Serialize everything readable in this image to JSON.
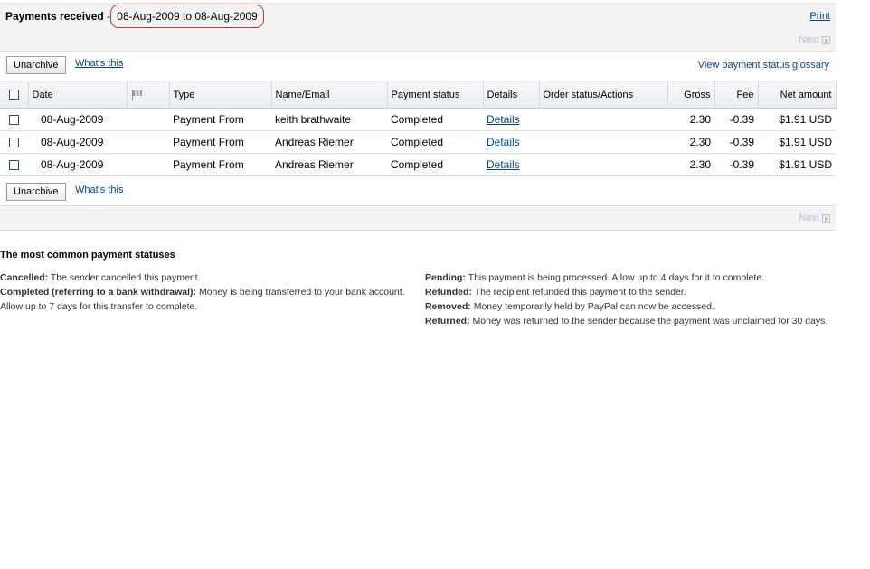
{
  "header": {
    "title": "Payments received",
    "dash": "-",
    "date_range": "08-Aug-2009 to 08-Aug-2009",
    "print_label": "Print"
  },
  "pager": {
    "next_label": "Next"
  },
  "actions": {
    "unarchive_label": "Unarchive",
    "whats_this_label": "What's this",
    "glossary_link": "View payment status glossary"
  },
  "table": {
    "columns": [
      "Date",
      "",
      "Type",
      "Name/Email",
      "Payment status",
      "Details",
      "Order status/Actions",
      "Gross",
      "Fee",
      "Net amount"
    ],
    "rows": [
      {
        "date": "08-Aug-2009",
        "type": "Payment From",
        "name": "keith brathwaite",
        "status": "Completed",
        "details": "Details",
        "order": "",
        "gross": "2.30",
        "fee": "-0.39",
        "net": "$1.91 USD"
      },
      {
        "date": "08-Aug-2009",
        "type": "Payment From",
        "name": "Andreas Riemer",
        "status": "Completed",
        "details": "Details",
        "order": "",
        "gross": "2.30",
        "fee": "-0.39",
        "net": "$1.91 USD"
      },
      {
        "date": "08-Aug-2009",
        "type": "Payment From",
        "name": "Andreas Riemer",
        "status": "Completed",
        "details": "Details",
        "order": "",
        "gross": "2.30",
        "fee": "-0.39",
        "net": "$1.91 USD"
      }
    ]
  },
  "glossary": {
    "title": "The most common payment statuses",
    "left": [
      {
        "term": "Cancelled:",
        "desc": "The sender cancelled this payment."
      },
      {
        "term": "Completed (referring to a bank withdrawal):",
        "desc": "Money is being transferred to your bank account. Allow up to 7 days for this transfer to complete."
      }
    ],
    "right": [
      {
        "term": "Pending:",
        "desc": "This payment is being processed. Allow up to 4 days for it to complete."
      },
      {
        "term": "Refunded:",
        "desc": "The recipient refunded this payment to the sender."
      },
      {
        "term": "Removed:",
        "desc": "Money temporarily held by PayPal can now be accessed."
      },
      {
        "term": "Returned:",
        "desc": "Money was returned to the sender because the payment was unclaimed for 30 days."
      }
    ]
  },
  "colors": {
    "link": "#084482",
    "highlight_circle": "#c0392b",
    "header_bg": "#f2f3f5"
  }
}
